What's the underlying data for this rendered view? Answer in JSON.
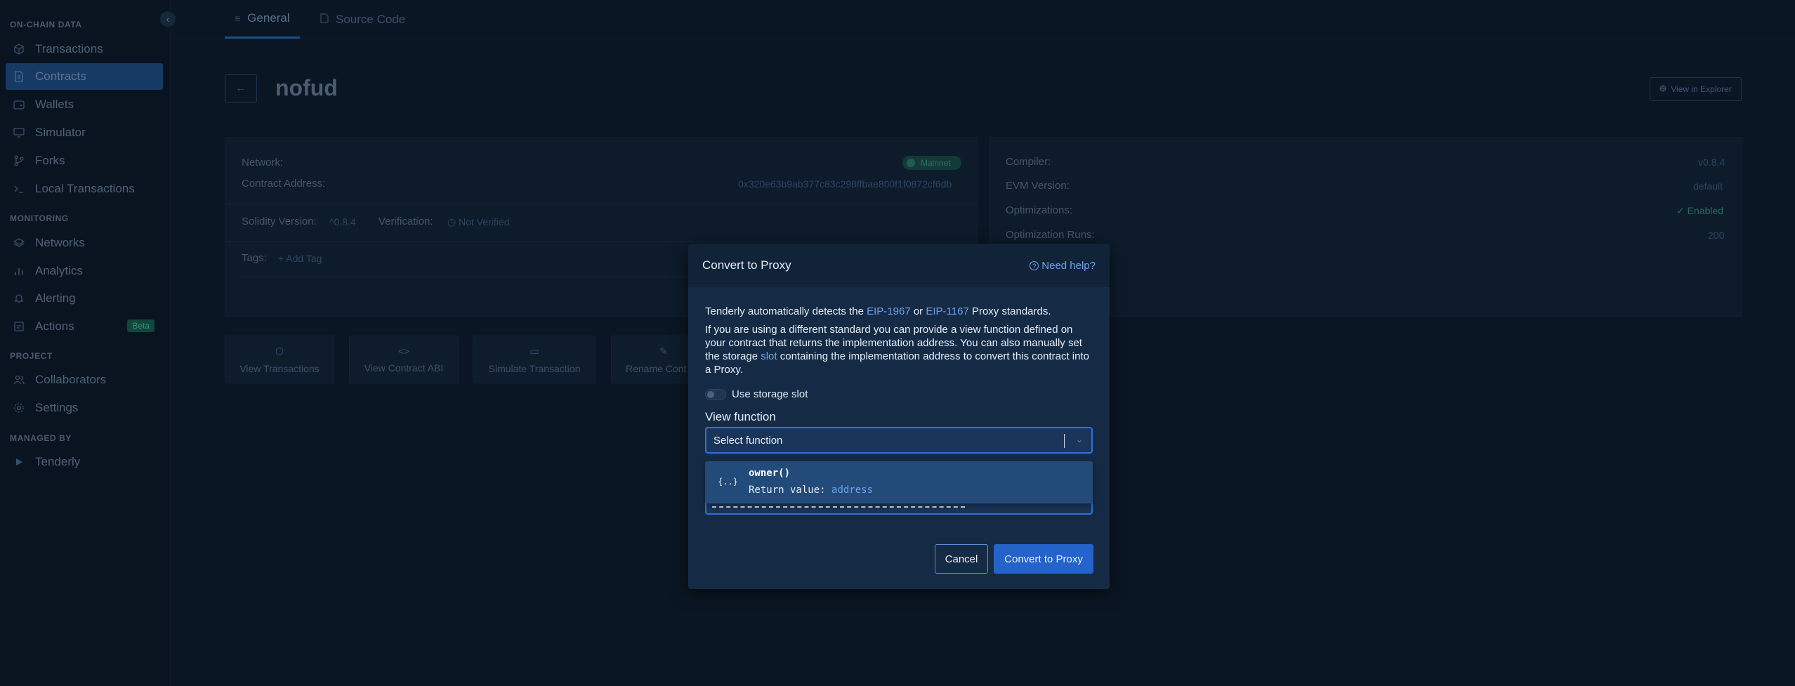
{
  "sidebar": {
    "collapse_icon": "‹",
    "sections": {
      "on_chain": "ON-CHAIN DATA",
      "monitoring": "MONITORING",
      "project": "PROJECT",
      "managed_by": "MANAGED BY"
    },
    "items": {
      "transactions": "Transactions",
      "contracts": "Contracts",
      "wallets": "Wallets",
      "simulator": "Simulator",
      "forks": "Forks",
      "local_transactions": "Local Transactions",
      "networks": "Networks",
      "analytics": "Analytics",
      "alerting": "Alerting",
      "actions": "Actions",
      "actions_badge": "Beta",
      "collaborators": "Collaborators",
      "settings": "Settings",
      "tenderly": "Tenderly"
    },
    "active_item": "contracts"
  },
  "tabs": {
    "general": "General",
    "source_code": "Source Code",
    "active": "general"
  },
  "header": {
    "title": "nofud",
    "explorer": "View in Explorer"
  },
  "details": {
    "network_label": "Network:",
    "network_value": "Mainnet",
    "address_label": "Contract Address:",
    "address_value": "0x320e63b9ab377c83c298ffbae800f1f0872cf6db",
    "solidity_label": "Solidity Version:",
    "solidity_value": "^0.8.4",
    "verification_label": "Verification:",
    "verification_value": "Not Verified",
    "tags_label": "Tags:",
    "add_tag": "+ Add Tag",
    "compiler_label": "Compiler:",
    "compiler_value": "v0.8.4",
    "evm_label": "EVM Version:",
    "evm_value": "default",
    "optimizations_label": "Optimizations:",
    "optimizations_value": "Enabled",
    "runs_label": "Optimization Runs:",
    "runs_value": "200"
  },
  "actions": {
    "view_transactions": "View Transactions",
    "view_abi": "View Contract ABI",
    "simulate": "Simulate Transaction",
    "rename": "Rename Cont"
  },
  "modal": {
    "title": "Convert to Proxy",
    "help": "Need help?",
    "p1_before": "Tenderly automatically detects the ",
    "p1_link1": "EIP-1967",
    "p1_or": " or ",
    "p1_link2": "EIP-1167",
    "p1_after": " Proxy standards.",
    "p2_before": "If you are using a different standard you can provide a view function defined on your contract that returns the implementation address. You can also manually set the storage ",
    "p2_link": "slot",
    "p2_after": " containing the implementation address to convert this contract into a Proxy.",
    "toggle_label": "Use storage slot",
    "field_label": "View function",
    "select_placeholder": "Select function",
    "option_icon": "{..}",
    "option_name": "owner()",
    "option_return_label": "Return value:",
    "option_return_type": "address",
    "cancel": "Cancel",
    "confirm": "Convert to Proxy"
  }
}
